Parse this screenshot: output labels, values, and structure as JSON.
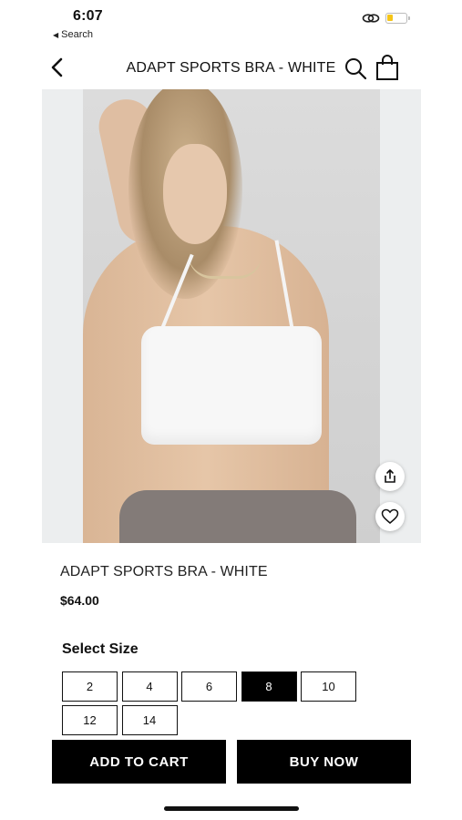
{
  "status_bar": {
    "time": "6:07",
    "back_label": "Search",
    "back_glyph": "◀",
    "link_icon": "link-icon",
    "battery_level": 0.3,
    "battery_color": "#f5c518"
  },
  "header": {
    "title": "ADAPT SPORTS BRA - WHITE",
    "back_icon": "chevron-left-icon",
    "search_icon": "search-icon",
    "bag_icon": "shopping-bag-icon"
  },
  "gallery": {
    "image_count": 5,
    "active_index": 0,
    "share_icon": "share-icon",
    "favorite_icon": "heart-icon"
  },
  "product": {
    "name": "ADAPT SPORTS BRA - WHITE",
    "price": "$64.00"
  },
  "sizes": {
    "label": "Select Size",
    "options": [
      "2",
      "4",
      "6",
      "8",
      "10",
      "12",
      "14"
    ],
    "selected": "8"
  },
  "actions": {
    "add_to_cart": "ADD TO CART",
    "buy_now": "BUY NOW"
  },
  "colors": {
    "primary": "#000000",
    "background": "#ffffff"
  }
}
